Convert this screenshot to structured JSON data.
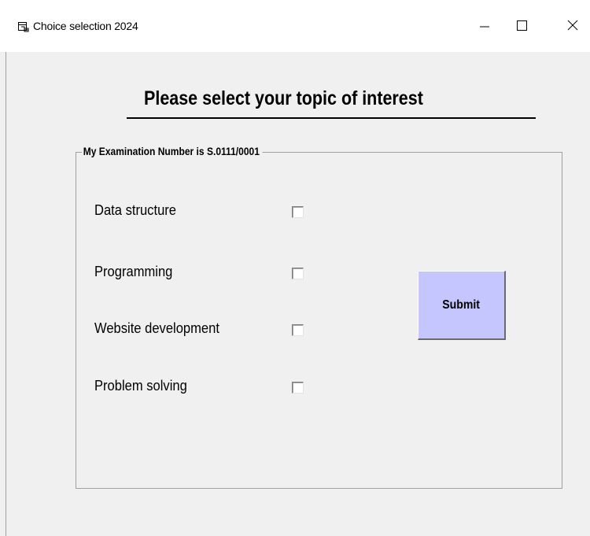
{
  "window": {
    "title": "Choice selection 2024",
    "icons": {
      "app": "app-window-icon",
      "minimize": "minimize-icon",
      "maximize": "maximize-icon",
      "close": "close-icon"
    }
  },
  "form": {
    "heading": "Please select your topic of interest",
    "group_label": "My Examination Number is S.0111/0001",
    "options": [
      {
        "label": "Data structure",
        "checked": false
      },
      {
        "label": "Programming",
        "checked": false
      },
      {
        "label": "Website development",
        "checked": false
      },
      {
        "label": "Problem solving",
        "checked": false
      }
    ],
    "submit_label": "Submit"
  },
  "colors": {
    "background": "#f0f0f0",
    "titlebar": "#ffffff",
    "submit_button": "#c6c6ff"
  }
}
